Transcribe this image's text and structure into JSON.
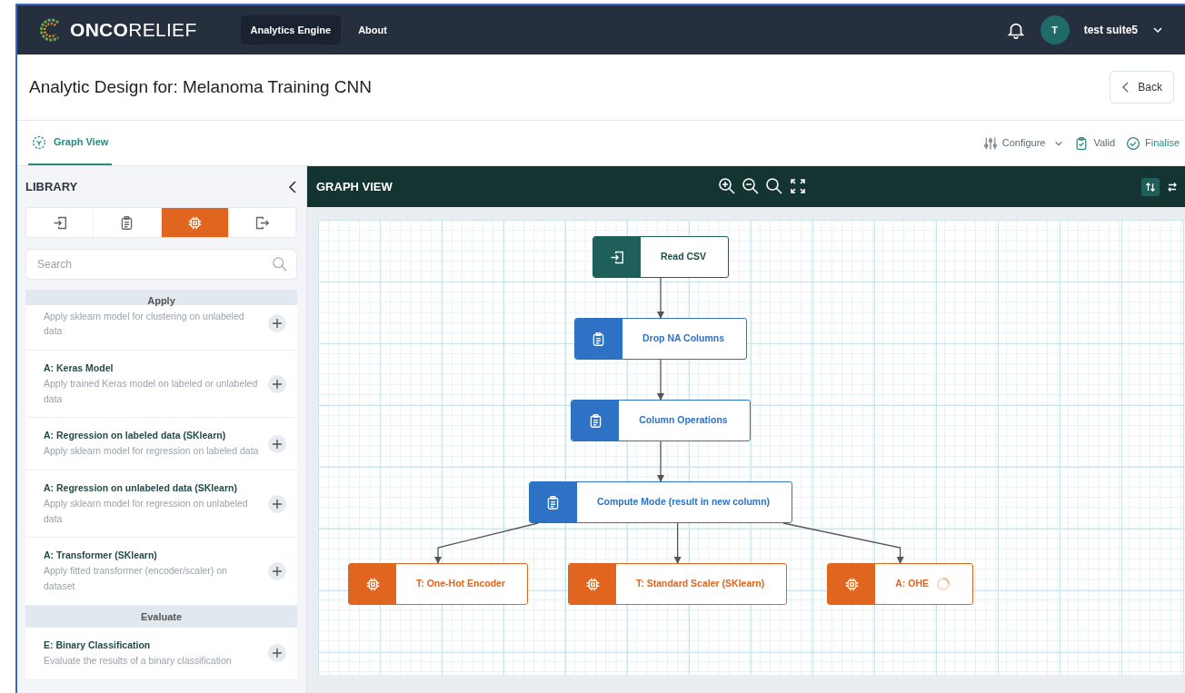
{
  "navbar": {
    "logo": "ONCO",
    "logo_rest": "RELIEF",
    "links": [
      {
        "label": "Analytics Engine",
        "selected": true
      },
      {
        "label": "About",
        "selected": false
      }
    ],
    "user": {
      "initial": "T",
      "name": "test suite5"
    }
  },
  "header": {
    "title": "Analytic Design for: Melanoma Training CNN",
    "back": "Back"
  },
  "tabs": [
    {
      "label": "Graph View",
      "selected": true
    }
  ],
  "actions": [
    {
      "kind": "configure",
      "label": "Configure"
    },
    {
      "kind": "valid",
      "label": "Valid"
    },
    {
      "kind": "finalise",
      "label": "Finalise"
    }
  ],
  "library": {
    "title": "LIBRARY",
    "tabs": [
      {
        "kind": "input",
        "selected": false
      },
      {
        "kind": "transform",
        "selected": false
      },
      {
        "kind": "apply",
        "selected": true
      },
      {
        "kind": "output",
        "selected": false
      }
    ],
    "search": {
      "placeholder": "Search"
    },
    "sections": [
      {
        "title": "Apply",
        "items": [
          {
            "description": "Apply sklearn model for clustering on unlabeled data"
          },
          {
            "name": "A: Keras Model",
            "description": "Apply trained Keras model on labeled or unlabeled data"
          },
          {
            "name": "A: Regression on labeled data (SKlearn)",
            "description": "Apply sklearn model for regression on labeled data"
          },
          {
            "name": "A: Regression on unlabeled data (SKlearn)",
            "description": "Apply sklearn model for regression on unlabeled data"
          },
          {
            "name": "A: Transformer (SKlearn)",
            "description": "Apply fitted transformer (encoder/scaler) on dataset"
          }
        ]
      },
      {
        "title": "Evaluate",
        "items": [
          {
            "name": "E: Binary Classification",
            "description": "Evaluate the results of a binary classification"
          }
        ]
      }
    ]
  },
  "graph": {
    "title": "GRAPH VIEW",
    "layout_toggles": [
      {
        "kind": "vertical",
        "selected": true
      },
      {
        "kind": "horizontal",
        "selected": false
      }
    ],
    "nodes": [
      {
        "label": "Read CSV",
        "kind": "input",
        "loading": false,
        "children": [
          {
            "label": "Drop NA Columns",
            "kind": "transform",
            "loading": false,
            "children": [
              {
                "label": "Column Operations",
                "kind": "transform",
                "loading": false,
                "children": [
                  {
                    "label": "Compute Mode (result in new column)",
                    "kind": "transform",
                    "loading": false,
                    "children": [
                      {
                        "label": "T: One-Hot Encoder",
                        "kind": "apply",
                        "loading": false
                      },
                      {
                        "label": "T: Standard Scaler (SKlearn)",
                        "kind": "apply",
                        "loading": false
                      },
                      {
                        "label": "A: OHE",
                        "kind": "apply",
                        "loading": true
                      }
                    ]
                  }
                ]
              }
            ]
          }
        ]
      }
    ]
  }
}
